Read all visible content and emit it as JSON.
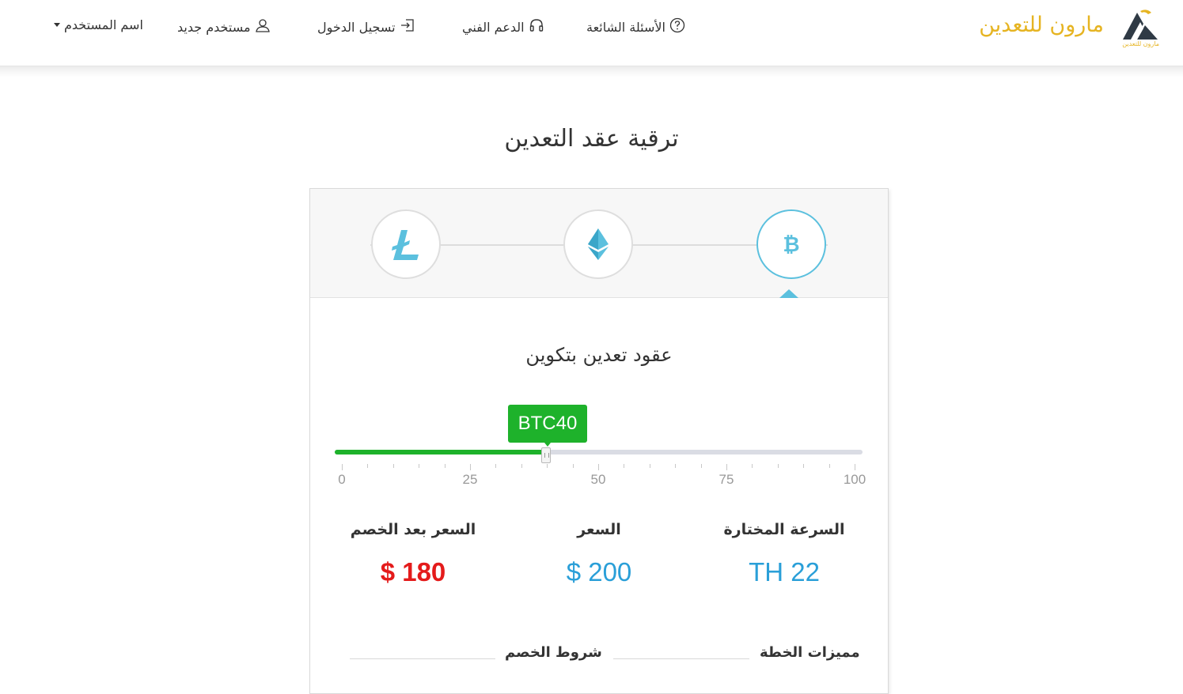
{
  "brand": {
    "name": "مارون للتعدين",
    "logo_caption": "مارون للتعدين",
    "color": "#e6b422"
  },
  "nav": {
    "faq": "الأسئلة الشائعة",
    "support": "الدعم الفني",
    "login": "تسجيل الدخول",
    "register": "مستخدم جديد",
    "username": "اسم المستخدم"
  },
  "page_title": "ترقية عقد التعدين",
  "coins": [
    {
      "name": "litecoin",
      "icon": "litecoin-icon",
      "active": false
    },
    {
      "name": "ethereum",
      "icon": "ethereum-icon",
      "active": false
    },
    {
      "name": "bitcoin",
      "icon": "bitcoin-icon",
      "active": true
    }
  ],
  "section_title": "عقود تعدين بتكوين",
  "slider": {
    "badge": "BTC40",
    "value": 40,
    "min": 0,
    "max": 100,
    "tick_labels": [
      "0",
      "25",
      "50",
      "75",
      "100"
    ],
    "fill_color": "#1eb22b"
  },
  "pricing": {
    "speed_label": "السرعة المختارة",
    "speed_value": "TH 22",
    "price_label": "السعر",
    "price_value": "$ 200",
    "discount_label": "السعر بعد الخصم",
    "discount_value": "$ 180"
  },
  "sections": {
    "features": "مميزات الخطة",
    "discount_terms": "شروط الخصم"
  },
  "colors": {
    "accent_blue": "#5bc0de",
    "price_blue": "#2a9fd8",
    "discount_red": "#e41b1b"
  }
}
